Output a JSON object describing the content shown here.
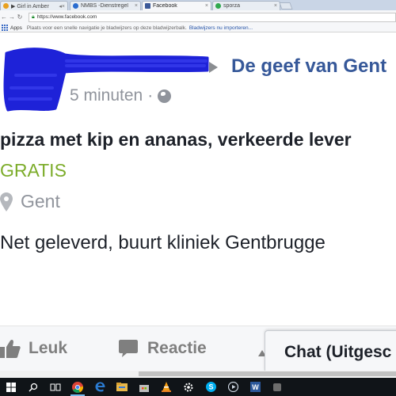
{
  "browser": {
    "tabs": [
      {
        "label": "▶ Girl in Amber",
        "icon_color": "#e8a020",
        "active": false
      },
      {
        "label": "NMBS -Dienstregel",
        "icon_color": "#2a6ccf",
        "active": false
      },
      {
        "label": "Facebook",
        "icon_color": "#3b5998",
        "active": true
      },
      {
        "label": "sporza",
        "icon_color": "#2fa84f",
        "active": false
      }
    ],
    "url": "https://www.facebook.com",
    "bookmarks_bar": {
      "apps_label": "Apps",
      "message": "Plaats voor een snelle navigatie je bladwijzers op deze bladwijzerbalk.",
      "import_link": "Bladwijzers nu importeren..."
    }
  },
  "post": {
    "group_name": "De geef van Gent",
    "timestamp": "5 minuten",
    "separator": "·",
    "title": "pizza met kip en ananas, verkeerde lever",
    "price": "GRATIS",
    "location": "Gent",
    "description": "Net geleverd, buurt kliniek Gentbrugge",
    "actions": {
      "like": "Leuk",
      "comment": "Reactie"
    }
  },
  "chat": {
    "label": "Chat (Uitgesc"
  },
  "taskbar": {
    "items": [
      "windows-start-icon",
      "search-icon",
      "task-view-icon",
      "chrome-icon",
      "edge-icon",
      "file-explorer-icon",
      "store-icon",
      "vlc-icon",
      "settings-icon",
      "skype-icon",
      "media-player-icon",
      "word-icon",
      "app-icon"
    ]
  },
  "colors": {
    "link_blue": "#365899",
    "price_green": "#7cac2a",
    "meta_gray": "#90949c",
    "scribble_blue": "#1e22d8"
  }
}
